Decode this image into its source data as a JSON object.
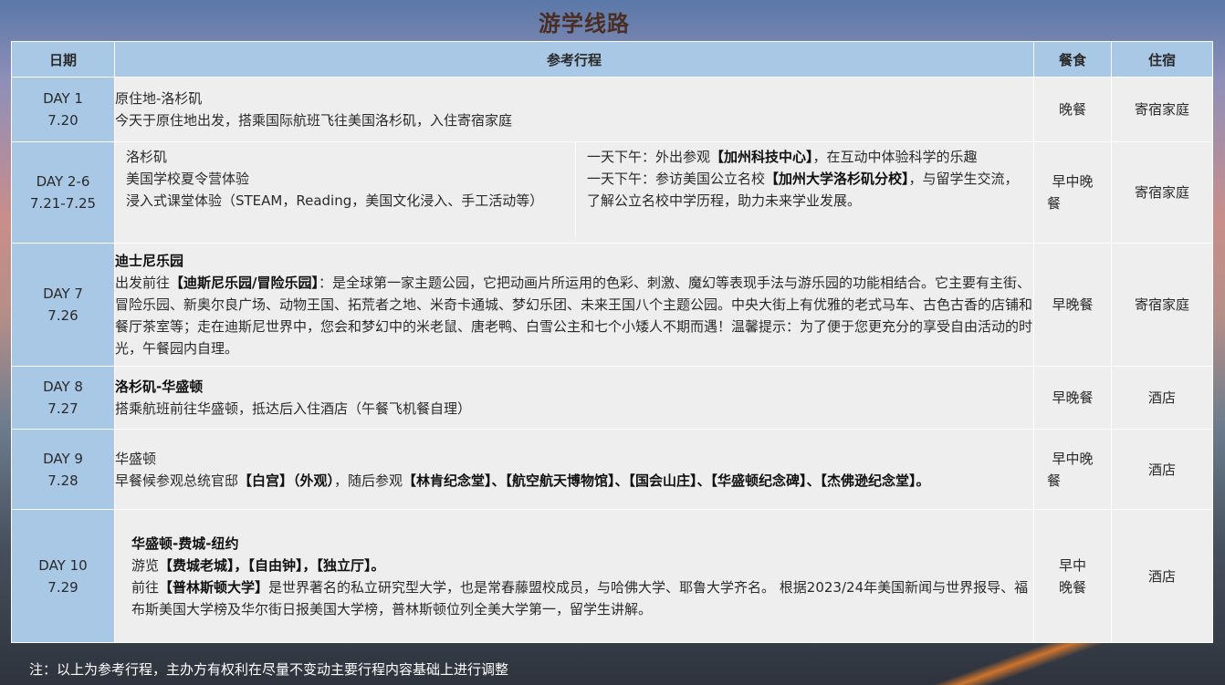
{
  "title": "游学线路",
  "headers": {
    "date": "日期",
    "itinerary": "参考行程",
    "meal": "餐食",
    "stay": "住宿"
  },
  "rows": [
    {
      "day": "DAY 1",
      "date": "7.20",
      "heading": "原住地-洛杉矶",
      "heading_bold": false,
      "body": "今天于原住地出发，搭乘国际航班飞往美国洛杉矶，入住寄宿家庭",
      "meal": "晚餐",
      "stay": "寄宿家庭"
    },
    {
      "day": "DAY 2-6",
      "date": "7.21-7.25",
      "left_lines": [
        "洛杉矶",
        "美国学校夏令营体验",
        "浸入式课堂体验（STEAM，Reading，美国文化浸入、手工活动等）"
      ],
      "right_a_pre": "一天下午：外出参观",
      "right_a_bold": "【加州科技中心】",
      "right_a_post": "，在互动中体验科学的乐趣",
      "right_b_pre": "一天下午：参访美国公立名校",
      "right_b_bold": "【加州大学洛杉矶分校】",
      "right_b_post": "，与留学生交流，了解公立名校中学历程，助力未来学业发展。",
      "meal_l1": "早中晚",
      "meal_l2": "餐",
      "stay": "寄宿家庭"
    },
    {
      "day": "DAY 7",
      "date": "7.26",
      "heading": "迪士尼乐园",
      "pre": "出发前往",
      "bold": "【迪斯尼乐园/冒险乐园】",
      "post": "：是全球第一家主题公园，它把动画片所运用的色彩、刺激、魔幻等表现手法与游乐园的功能相结合。它主要有主街、冒险乐园、新奥尔良广场、动物王国、拓荒者之地、米奇卡通城、梦幻乐团、未来王国八个主题公园。中央大街上有优雅的老式马车、古色古香的店铺和餐厅茶室等；走在迪斯尼世界中，您会和梦幻中的米老鼠、唐老鸭、白雪公主和七个小矮人不期而遇！温馨提示：为了便于您更充分的享受自由活动的时光，午餐园内自理。",
      "meal": "早晚餐",
      "stay": "寄宿家庭"
    },
    {
      "day": "DAY 8",
      "date": "7.27",
      "heading": "洛杉矶-华盛顿",
      "body": "搭乘航班前往华盛顿，抵达后入住酒店（午餐飞机餐自理）",
      "meal": "早晚餐",
      "stay": "酒店"
    },
    {
      "day": "DAY 9",
      "date": "7.28",
      "heading": "华盛顿",
      "pre": "早餐候参观总统官邸",
      "b1": "【白宫】（外观）",
      "mid": "，随后参观",
      "b2": "【林肯纪念堂】、【航空航天博物馆】、【国会山庄】、【华盛顿纪念碑】、【杰佛逊纪念堂】。",
      "meal_l1": "早中晚",
      "meal_l2": "餐",
      "stay": "酒店"
    },
    {
      "day": "DAY 10",
      "date": "7.29",
      "heading": "华盛顿-费城-纽约",
      "line2_pre": "游览",
      "line2_bold": "【费城老城】，【自由钟】，【独立厅】。",
      "line3_pre": "前往",
      "line3_bold": "【普林斯顿大学】",
      "line3_post": "是世界著名的私立研究型大学，也是常春藤盟校成员，与哈佛大学、耶鲁大学齐名。 根据2023/24年美国新闻与世界报导、福布斯美国大学榜及华尔街日报美国大学榜，普林斯顿位列全美大学第一，留学生讲解。",
      "meal_l1": "早中",
      "meal_l2": "晚餐",
      "stay": "酒店"
    }
  ],
  "note": "注：以上为参考行程，主办方有权利在尽量不变动主要行程内容基础上进行调整"
}
